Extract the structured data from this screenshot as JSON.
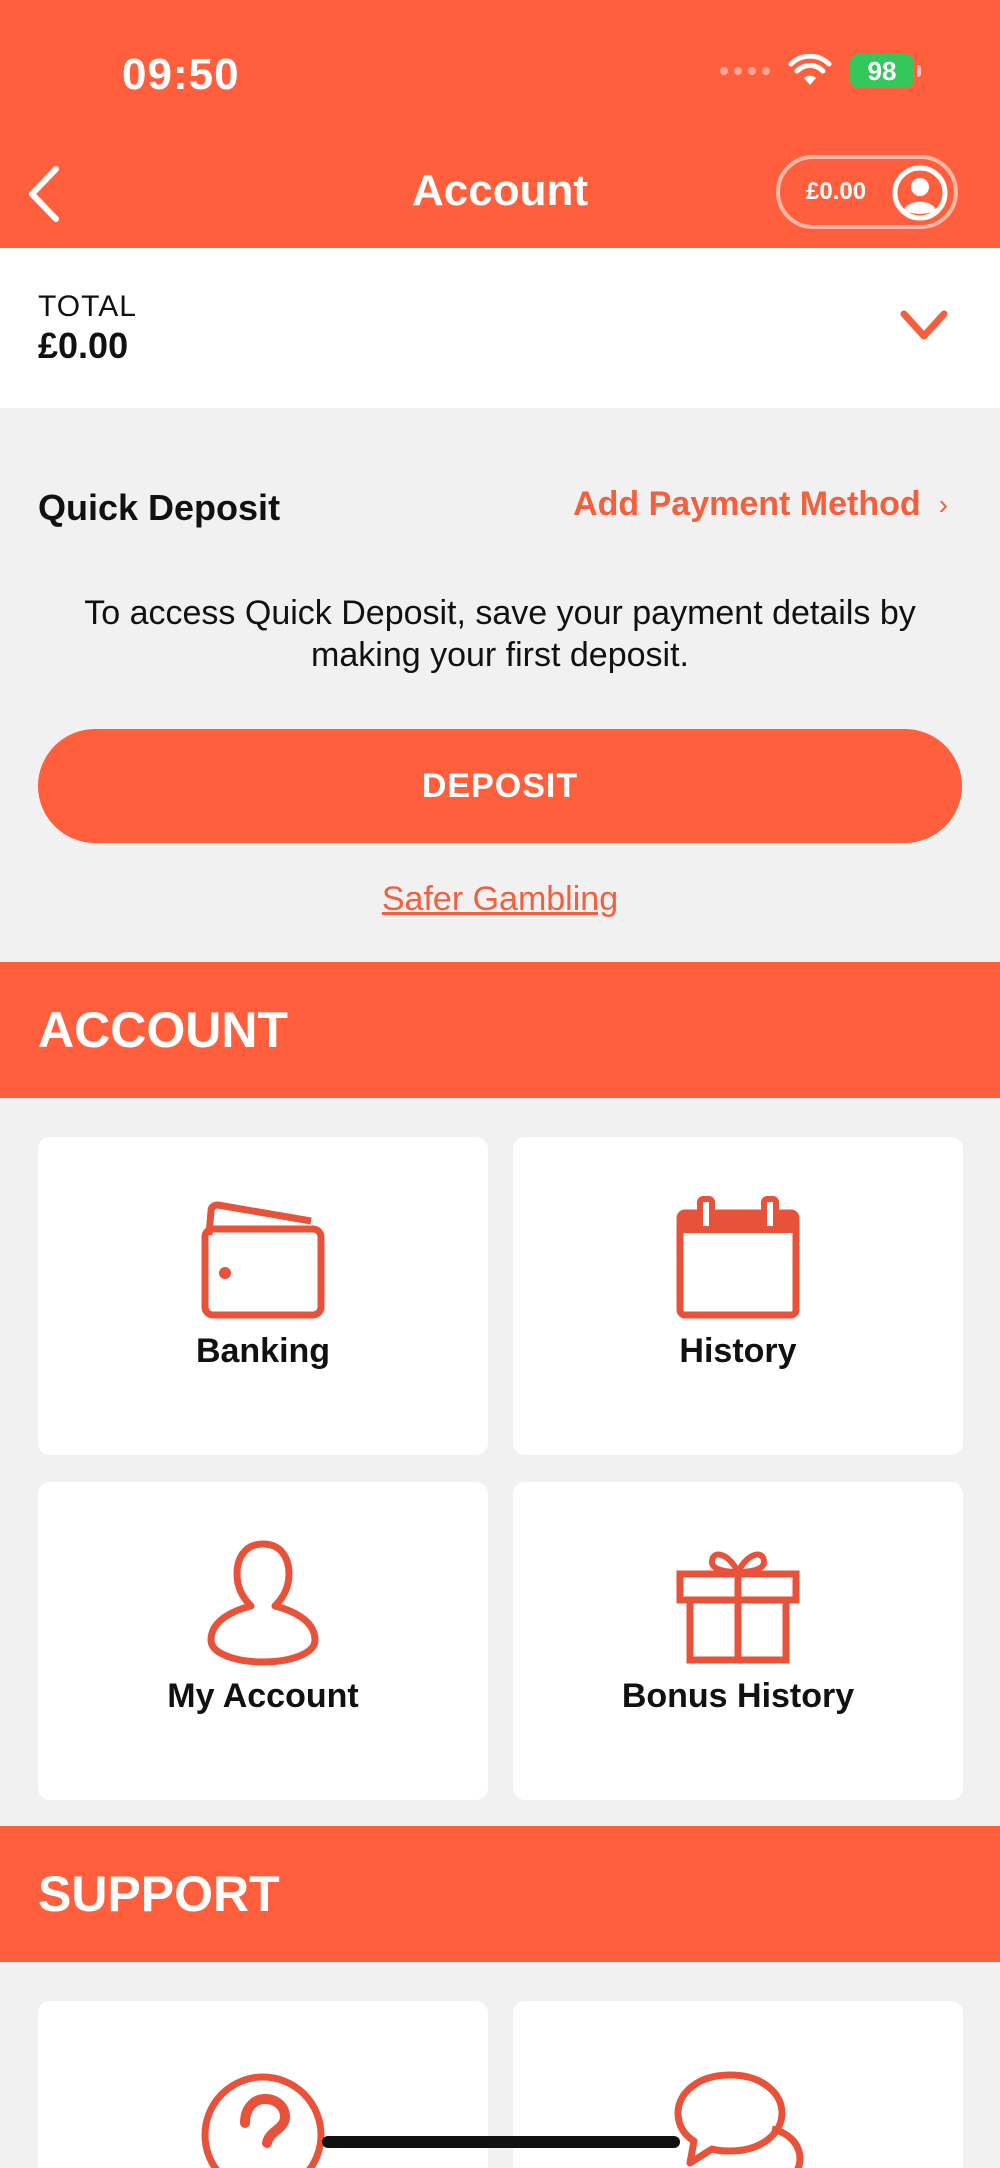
{
  "status_bar": {
    "time": "09:50",
    "battery": "98"
  },
  "header": {
    "title": "Account",
    "balance": "£0.00"
  },
  "total": {
    "label": "TOTAL",
    "amount": "£0.00"
  },
  "quick_deposit": {
    "title": "Quick Deposit",
    "add_payment_label": "Add Payment Method",
    "message": "To access Quick Deposit, save your payment details by making your first deposit.",
    "deposit_button": "DEPOSIT",
    "safer_gambling_link": "Safer Gambling"
  },
  "account_section": {
    "heading": "ACCOUNT",
    "tiles": [
      {
        "label": "Banking",
        "icon": "wallet-icon"
      },
      {
        "label": "History",
        "icon": "calendar-icon"
      },
      {
        "label": "My Account",
        "icon": "user-icon"
      },
      {
        "label": "Bonus History",
        "icon": "gift-icon"
      }
    ]
  },
  "support_section": {
    "heading": "SUPPORT",
    "tiles": [
      {
        "icon": "help-icon"
      },
      {
        "icon": "chat-icon"
      }
    ]
  },
  "colors": {
    "brand": "#ff5f3c",
    "link": "#f4603d",
    "background": "#f1f1f1",
    "battery": "#34c759"
  }
}
